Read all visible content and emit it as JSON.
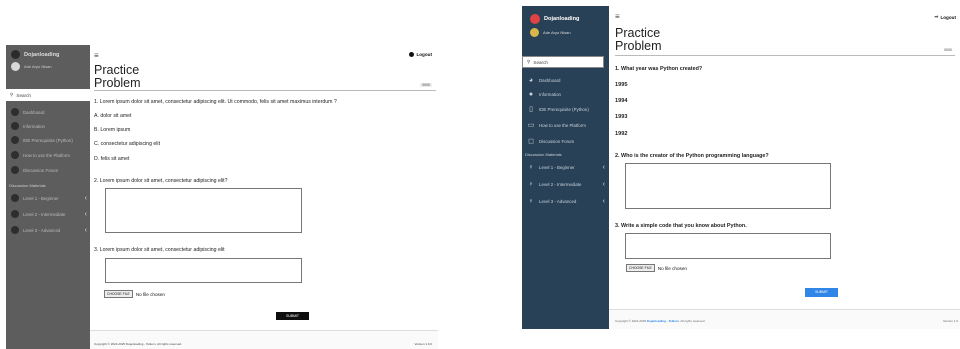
{
  "left": {
    "app_name": "Dojanloading",
    "user_name": "Ade Aryo Nisan",
    "search_label": "Search",
    "nav_items": [
      "Dashboard",
      "Information",
      "IDE Prerequisite (Python)",
      "How to use the Platform",
      "Discussion Forum"
    ],
    "section_label": "Discussion Materials",
    "levels": [
      "Level 1 - Beginner",
      "Level 2 - Intermediate",
      "Level 3 - Advanced"
    ],
    "logout_label": "Logout",
    "title_line1": "Practice",
    "title_line2": "Problem",
    "badge": "0000",
    "q1": "1. Lorem ipsum dolor sit amet, consectetur adipiscing elit. Ut commodo, felis sit amet maximus interdum ?",
    "options": [
      "A. dolor sit amet",
      "B. Lorem ipsum",
      "C. consectetur adipiscing elit",
      "D. felis sit amet"
    ],
    "q2": "2. Lorem ipsum dolor sit amet, consectetur adipiscing elit?",
    "q3": "3. Lorem ipsum dolor sit amet, consectetur adipiscing elit",
    "choose_file": "CHOOSE FILE",
    "no_file": "No file chosen",
    "submit": "SUBMIT",
    "copyright": "Copyright © 2024-2025 Dojanloading - Telkom. All rights reserved.",
    "version": "Version 1.0.0",
    "sidebar_color": "#5d5d5d"
  },
  "right": {
    "app_name": "Dojanloading",
    "user_name": "Ade Aryo Nisan",
    "search_label": "Search",
    "nav_items": [
      "Dashboard",
      "Information",
      "IDE Prerequisite (Python)",
      "How to use the Platform",
      "Discussion Forum"
    ],
    "section_label": "Discussion Materials",
    "levels": [
      "Level 1 - Beginner",
      "Level 2 - Intermediate",
      "Level 3 - Advanced"
    ],
    "logout_label": "Logout",
    "title_line1": "Practice",
    "title_line2": "Problem",
    "badge": "0000",
    "q1": "1. What year was Python created?",
    "options": [
      "1995",
      "1994",
      "1993",
      "1992"
    ],
    "q2": "2. Who is the creator of the Python programming language?",
    "q3": "3. Write a simple code that you know about Python.",
    "choose_file": "CHOOSE FILE",
    "no_file": "No file chosen",
    "submit": "SUBMIT",
    "copyright_prefix": "Copyright © 2024-2025 ",
    "copyright_brand": "Dojanloading - Telkom",
    "copyright_suffix": ". All rights reserved.",
    "version": "Version 1.0",
    "sidebar_color": "#294156",
    "accent_color": "#2f86e6"
  }
}
